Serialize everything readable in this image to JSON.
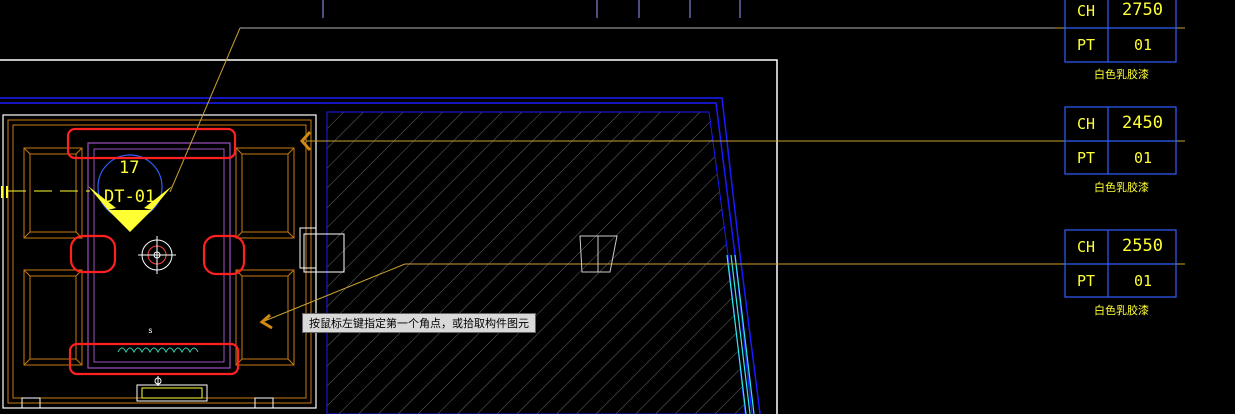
{
  "colors": {
    "background": "#000000",
    "outline_white": "#ffffff",
    "outline_blue": "#1a1aff",
    "orange": "#c87a10",
    "yellow": "#ffff33",
    "cyan": "#33e6e6",
    "red_markup": "#ff2020",
    "leader": "#c8a030"
  },
  "ceiling_tags": [
    {
      "ch_label": "CH",
      "ch_value": "2750",
      "pt_label": "PT",
      "pt_value": "01",
      "finish": "白色乳胶漆"
    },
    {
      "ch_label": "CH",
      "ch_value": "2450",
      "pt_label": "PT",
      "pt_value": "01",
      "finish": "白色乳胶漆"
    },
    {
      "ch_label": "CH",
      "ch_value": "2550",
      "pt_label": "PT",
      "pt_value": "01",
      "finish": "白色乳胶漆"
    }
  ],
  "fixture_tag": {
    "number": "17",
    "code": "DT-01"
  },
  "small_label_s": "s",
  "tooltip": "按鼠标左键指定第一个角点，或拾取构件图元"
}
